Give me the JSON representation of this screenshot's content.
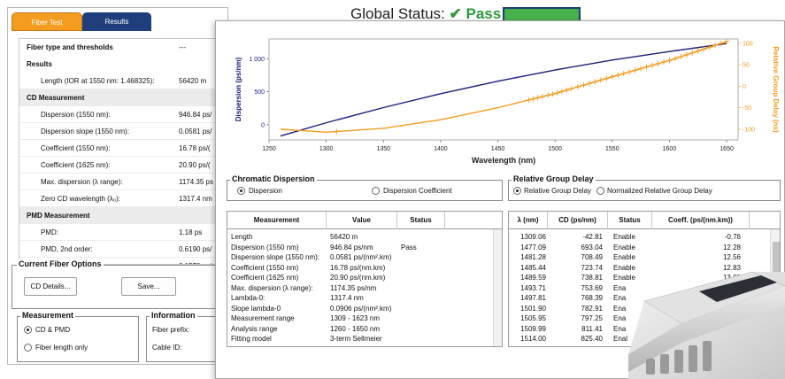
{
  "tabs": {
    "fiber_test": "Fiber Test",
    "results": "Results"
  },
  "results_rows": [
    {
      "label": "Fiber type and thresholds",
      "value": "---",
      "kind": "top"
    },
    {
      "label": "Results",
      "value": "",
      "kind": "top"
    },
    {
      "label": "Length (IOR at 1550 nm: 1.468325):",
      "value": "56420 m",
      "kind": "item"
    },
    {
      "label": "CD Measurement",
      "value": "",
      "kind": "head"
    },
    {
      "label": "Dispersion (1550 nm):",
      "value": "946.84 ps/",
      "kind": "item"
    },
    {
      "label": "Dispersion slope (1550 nm):",
      "value": "0.0581 ps/",
      "kind": "item"
    },
    {
      "label": "Coefficient (1550 nm):",
      "value": "16.78 ps/(",
      "kind": "item"
    },
    {
      "label": "Coefficient (1625 nm):",
      "value": "20.90 ps/(",
      "kind": "item"
    },
    {
      "label": "Max. dispersion (λ range):",
      "value": "1174.35 ps",
      "kind": "item"
    },
    {
      "label": "Zero CD wavelength (λ₀):",
      "value": "1317.4 nm",
      "kind": "item"
    },
    {
      "label": "PMD Measurement",
      "value": "",
      "kind": "head"
    },
    {
      "label": "PMD:",
      "value": "1.18 ps",
      "kind": "item"
    },
    {
      "label": "PMD, 2nd order:",
      "value": "0.6190 ps/",
      "kind": "item"
    },
    {
      "label": "Coefficient:",
      "value": "0.1570 ps/",
      "kind": "item"
    }
  ],
  "current_fiber_options": {
    "title": "Current Fiber Options",
    "cd_details_button": "CD Details...",
    "save_button": "Save..."
  },
  "measurement_group": {
    "title": "Measurement",
    "options": [
      {
        "label": "CD & PMD",
        "selected": true
      },
      {
        "label": "Fiber length only",
        "selected": false
      }
    ]
  },
  "information_group": {
    "title": "Information",
    "fiber_prefix_label": "Fiber prefix:",
    "cable_id_label": "Cable ID:"
  },
  "global_status": {
    "label": "Global Status:",
    "check": "✔",
    "value": "Pass"
  },
  "chart_data": {
    "type": "line",
    "xlabel": "Wavelength (nm)",
    "ylabel_left": "Dispersion (ps/nm)",
    "ylabel_right": "Relative Group Delay (ns)",
    "x_ticks": [
      1250,
      1300,
      1350,
      1400,
      1450,
      1500,
      1550,
      1600,
      1650
    ],
    "x_tick_labels": [
      "1250",
      "1300",
      "1350",
      "1400",
      "1450",
      "1500",
      "1550",
      "1600",
      "1650"
    ],
    "y_left_ticks": [
      0,
      500,
      1000
    ],
    "y_left_tick_labels": [
      "0",
      "500",
      "1 000"
    ],
    "y_right_ticks": [
      -100,
      -50,
      0,
      50,
      100
    ],
    "y_right_tick_labels": [
      "-100",
      "-50",
      "0",
      "50",
      "100"
    ],
    "xlim": [
      1250,
      1660
    ],
    "ylim_left": [
      -230,
      1300
    ],
    "ylim_right": [
      -125,
      110
    ],
    "series": [
      {
        "color": "#1a1e7a",
        "axis": "left",
        "x": [
          1260,
          1300,
          1350,
          1400,
          1450,
          1500,
          1550,
          1600,
          1650
        ],
        "y": [
          -170,
          30,
          260,
          470,
          660,
          830,
          980,
          1110,
          1230
        ]
      },
      {
        "color": "#f39c1f",
        "axis": "right",
        "x": [
          1260,
          1300,
          1350,
          1400,
          1450,
          1500,
          1550,
          1600,
          1650
        ],
        "y": [
          -100,
          -107,
          -98,
          -78,
          -50,
          -17,
          22,
          60,
          104
        ]
      }
    ],
    "markers": {
      "series_index": 1,
      "x": [
        1309,
        1477,
        1481,
        1485,
        1489,
        1494,
        1498,
        1502,
        1506,
        1510,
        1514,
        1520,
        1525,
        1530,
        1535,
        1540,
        1545,
        1550,
        1555,
        1560,
        1565,
        1570,
        1575,
        1580,
        1585,
        1590,
        1595,
        1600,
        1605,
        1610,
        1615,
        1620,
        1625,
        1630,
        1635,
        1640,
        1645,
        1650
      ]
    },
    "grid": false
  },
  "chromatic_dispersion": {
    "title": "Chromatic Dispersion",
    "options": [
      {
        "label": "Dispersion",
        "selected": true
      },
      {
        "label": "Dispersion Coefficient",
        "selected": false
      }
    ]
  },
  "relative_group_delay": {
    "title": "Relative Group Delay",
    "options": [
      {
        "label": "Relative Group Delay",
        "selected": true
      },
      {
        "label": "Normalized Relative Group Delay",
        "selected": false
      }
    ]
  },
  "measurement_table": {
    "headers": [
      "Measurement",
      "Value",
      "Status"
    ],
    "rows": [
      [
        "Length",
        "56420 m",
        ""
      ],
      [
        "Dispersion (1550 nm)",
        "946.84 ps/nm",
        "Pass"
      ],
      [
        "Dispersion slope (1550 nm):",
        "0.0581 ps/(nm².km)",
        ""
      ],
      [
        "Coefficient (1550 nm)",
        "16.78 ps/(nm.km)",
        ""
      ],
      [
        "Coefficient (1625 nm)",
        "20.90 ps/(nm.km)",
        ""
      ],
      [
        "Max. dispersion (λ range):",
        "1174.35 ps/nm",
        ""
      ],
      [
        "Lambda-0:",
        "1317.4 nm",
        ""
      ],
      [
        "Slope lambda-0",
        "0.0906 ps/(nm².km)",
        ""
      ],
      [
        "Measurement range",
        "1309 - 1623 nm",
        ""
      ],
      [
        "Analysis range",
        "1260 - 1650 nm",
        ""
      ],
      [
        "Fitting model",
        "3-term Sellmeier",
        ""
      ]
    ]
  },
  "wavelength_table": {
    "headers": [
      "λ (nm)",
      "CD (ps/nm)",
      "Status",
      "Coeff. (ps/(nm.km))"
    ],
    "rows": [
      [
        "1309.06",
        "-42.81",
        "Enable",
        "-0.76"
      ],
      [
        "1477.09",
        "693.04",
        "Enable",
        "12.28"
      ],
      [
        "1481.28",
        "708.49",
        "Enable",
        "12.56"
      ],
      [
        "1485.44",
        "723.74",
        "Enable",
        "12.83"
      ],
      [
        "1489.59",
        "738.81",
        "Enable",
        "13.09"
      ],
      [
        "1493.71",
        "753.69",
        "Ena",
        ""
      ],
      [
        "1497.81",
        "768.39",
        "Ena",
        ""
      ],
      [
        "1501.90",
        "782.91",
        "Ena",
        ""
      ],
      [
        "1505.95",
        "797.25",
        "Ena",
        ""
      ],
      [
        "1509.99",
        "811.41",
        "Ena",
        ""
      ],
      [
        "1514.00",
        "825.40",
        "Enal",
        ""
      ]
    ]
  }
}
